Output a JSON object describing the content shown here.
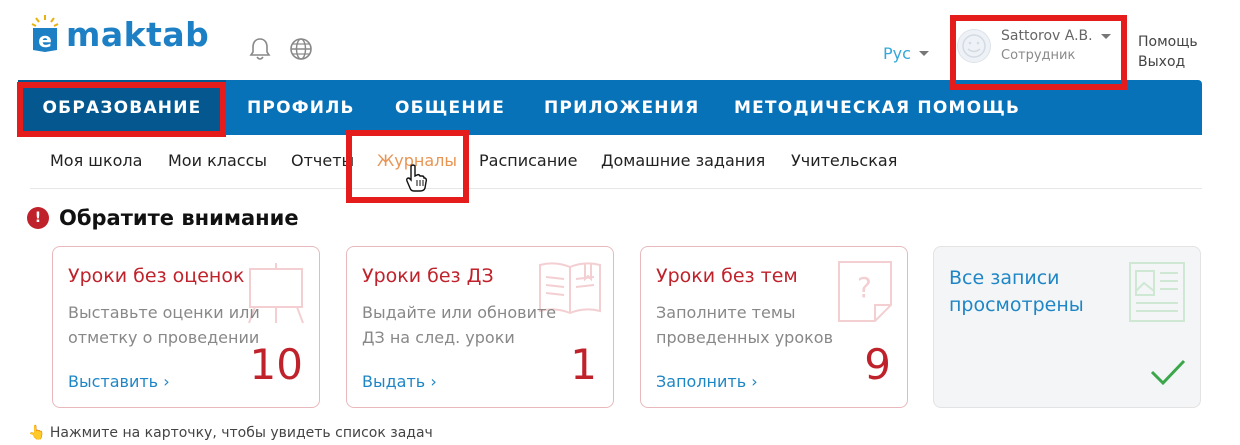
{
  "brand": {
    "name": "maktab"
  },
  "header": {
    "language": "Рус",
    "user_name": "Sattorov A.B.",
    "user_role": "Сотрудник",
    "help_label": "Помощь",
    "logout_label": "Выход"
  },
  "nav": {
    "items": [
      {
        "label": "ОБРАЗОВАНИЕ"
      },
      {
        "label": "ПРОФИЛЬ"
      },
      {
        "label": "ОБЩЕНИЕ"
      },
      {
        "label": "ПРИЛОЖЕНИЯ"
      },
      {
        "label": "МЕТОДИЧЕСКАЯ ПОМОЩЬ"
      }
    ],
    "active": "ОБРАЗОВАНИЕ"
  },
  "subnav": {
    "items": [
      {
        "label": "Моя школа"
      },
      {
        "label": "Мои классы"
      },
      {
        "label": "Отчеты"
      },
      {
        "label": "Журналы"
      },
      {
        "label": "Расписание"
      },
      {
        "label": "Домашние задания"
      },
      {
        "label": "Учительская"
      }
    ],
    "active": "Журналы"
  },
  "attention": {
    "title": "Обратите внимание",
    "icon": "!"
  },
  "cards": [
    {
      "title": "Уроки без оценок",
      "desc_line1": "Выставьте оценки или",
      "desc_line2": "отметку о проведении",
      "count": "10",
      "link": "Выставить ›",
      "icon": "easel-icon"
    },
    {
      "title": "Уроки без ДЗ",
      "desc_line1": "Выдайте или обновите",
      "desc_line2": "ДЗ на след. уроки",
      "count": "1",
      "link": "Выдать ›",
      "icon": "open-book-icon"
    },
    {
      "title": "Уроки без тем",
      "desc_line1": "Заполните темы",
      "desc_line2": "проведенных уроков",
      "count": "9",
      "link": "Заполнить ›",
      "icon": "question-page-icon"
    },
    {
      "title_line1": "Все записи",
      "title_line2": "просмотрены",
      "icon": "document-icon",
      "status_icon": "checkmark-icon"
    }
  ],
  "footer": {
    "hint": "👆 Нажмите на карточку, чтобы увидеть список задач"
  },
  "colors": {
    "nav_bg": "#0872b8",
    "nav_active": "#05588f",
    "accent": "#c0222b",
    "link": "#1f86c6",
    "subnav_active": "#e89452",
    "highlight": "#e51c1c"
  }
}
